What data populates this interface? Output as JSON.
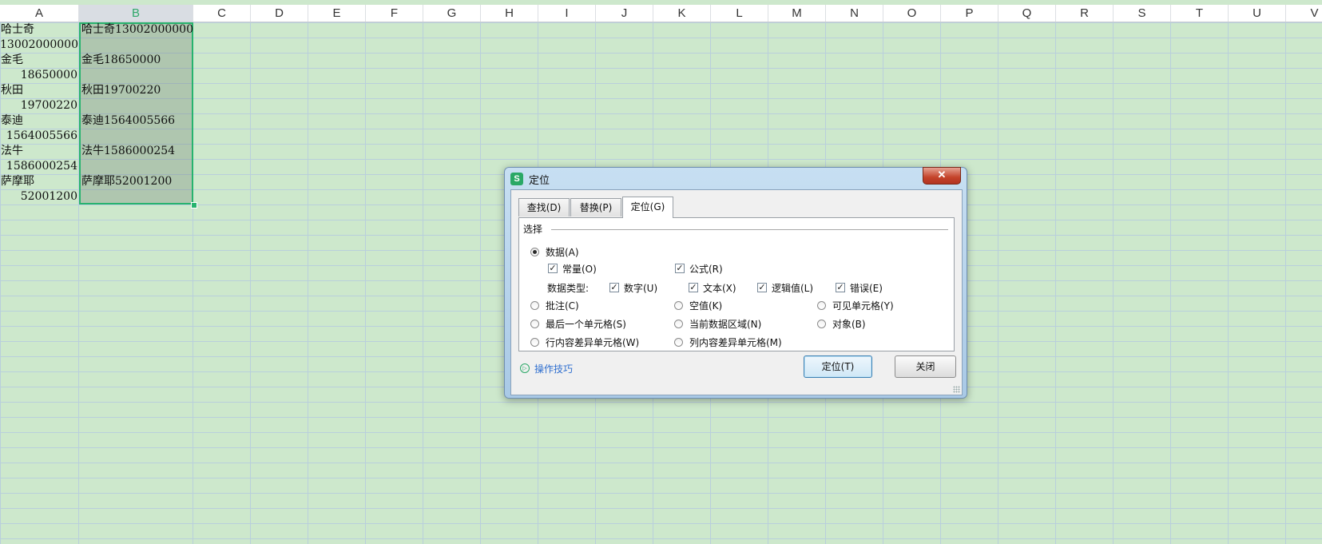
{
  "sheet": {
    "columns": [
      "A",
      "B",
      "C",
      "D",
      "E",
      "F",
      "G",
      "H",
      "I",
      "J",
      "K",
      "L",
      "M",
      "N",
      "O",
      "P",
      "Q",
      "R",
      "S",
      "T",
      "U",
      "V"
    ],
    "selected_column": "B",
    "colA": {
      "r1": "哈士奇",
      "r2": "13002000000",
      "r3": "金毛",
      "r4": "18650000",
      "r5": "秋田",
      "r6": "19700220",
      "r7": "泰迪",
      "r8": "1564005566",
      "r9": "法牛",
      "r10": "1586000254",
      "r11": "萨摩耶",
      "r12": "52001200"
    },
    "colB": {
      "r1": "哈士奇13002000000",
      "r3": "金毛18650000",
      "r5": "秋田19700220",
      "r7": "泰迪1564005566",
      "r9": "法牛1586000254",
      "r11": "萨摩耶52001200"
    }
  },
  "dialog": {
    "icon": "wps-s-icon",
    "icon_glyph": "S",
    "title": "定位",
    "close_glyph": "✕",
    "tabs": {
      "find": "查找(D)",
      "replace": "替换(P)",
      "goto": "定位(G)"
    },
    "active_tab": "定位(G)",
    "group_label": "选择",
    "options": {
      "data": "数据(A)",
      "constants": "常量(O)",
      "formulas": "公式(R)",
      "data_type_label": "数据类型:",
      "numbers": "数字(U)",
      "text": "文本(X)",
      "logical": "逻辑值(L)",
      "errors": "错误(E)",
      "comments": "批注(C)",
      "blanks": "空值(K)",
      "visible_cells": "可见单元格(Y)",
      "last_cell": "最后一个单元格(S)",
      "current_region": "当前数据区域(N)",
      "objects": "对象(B)",
      "row_differences": "行内容差异单元格(W)",
      "column_differences": "列内容差异单元格(M)"
    },
    "selected_radio": "数据(A)",
    "check_glyph": "✓",
    "tips_glyph": "▷",
    "tips_link": "操作技巧",
    "buttons": {
      "goto": "定位(T)",
      "close": "关闭"
    }
  }
}
